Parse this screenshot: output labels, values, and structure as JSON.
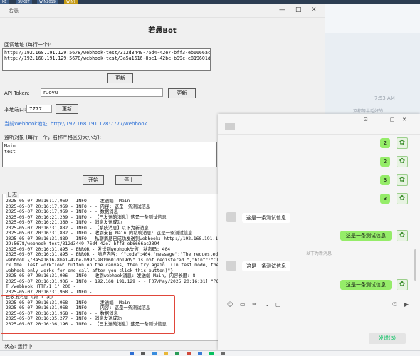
{
  "taskbar_top": {
    "tabs": [
      "KE",
      "SUKBT",
      "WIN2019",
      "WIN7"
    ]
  },
  "background": {
    "time": "7:53 AM",
    "snippet": "京都等半毛好的..."
  },
  "tk_window": {
    "title": "若愚",
    "heading": "若愚Bot",
    "callback_label": "回调地址 (每行一个):",
    "callback_text": "http://192.168.191.129:5678/webhook-test/312d3449-76d4-42e7-bff3-eb6666ac2394\nhttp://192.168.191.129:5678/webhook-test/3a5a1616-8be1-42be-b99c-e819601db19d",
    "update_btn_1": "更新",
    "api_token_label": "API Token:",
    "api_token_value": "ruoyu",
    "update_btn_2": "更新",
    "port_label": "本地端口:",
    "port_value": "7777",
    "update_btn_3": "更新",
    "webhook_link": "当前Webhook地址: http://192.168.191.128:7777/webhook",
    "monitor_label": "监听对象 (每行一个，名称严格区分大小写):",
    "monitor_text": "Main\ntest",
    "start_btn": "开始",
    "stop_btn": "停止",
    "log_caption": "日志",
    "log_text": "2025-05-07 20:16:17,969 - INFO - - 发送端: Main\n2025-05-07 20:16:17,969 - INFO - - 内容: 这是一条测试信息\n2025-05-07 20:16:17,969 - INFO - - 数据消息\n2025-05-07 20:16:21,209 - INFO - 【已发送的消息】这是一条测试信息\n2025-05-07 20:16:21,360 - INFO - 消息发送成功\n2025-05-07 20:16:31,882 - INFO - 【系统消息】以下为新消息\n2025-05-07 20:16:31,882 - INFO - 收到来自 Main 的私聊消息: 这是一条测试信息\n2025-05-07 20:16:31,889 - INFO - 私聊消息已成功发送到webhook: http://192.168.191.1\n29:5678/webhook-test/312d3449-76d4-42e7-bff3-eb6666ac2394\n2025-05-07 20:16:31,895 - ERROR - 发送到webhook失败，状态码: 404\n2025-05-07 20:16:31,895 - ERROR - 响应内容: {\"code\":404,\"message\":\"The requested\nwebhook \\\"3a5a1616-8be1-42be-b99c-e819601db19d\\\" is not registered.\",\"hint\":\"Cli\nck the 'Test workflow' button on the canvas, then try again. (In test mode, the\nwebhook only works for one call after you click this button)\"}\n2025-05-07 20:16:31,906 - INFO - 收到webhook消息: 发送端 Main, 内容长度: 8\n2025-05-07 20:16:31,906 - INFO - 192.168.191.129 - - [07/May/2025 20:16:31] \"POS\nT /webhook HTTP/1.1\" 200 -\n2025-05-07 20:16:31,968 - INFO -\n已收发消息 (第 1 次)\n2025-05-07 20:16:31,968 - INFO - - 发送端: Main\n2025-05-07 20:16:31,968 - INFO - - 内容: 这是一条测试信息\n2025-05-07 20:16:31,968 - INFO - - 数据消息\n2025-05-07 20:16:35,277 - INFO - 消息发送成功\n2025-05-07 20:16:36,196 - INFO - 【已发送的消息】这是一条测试信息",
    "status": "状态: 运行中"
  },
  "chat_window": {
    "controls": [
      "⊡",
      "—",
      "□",
      "✕"
    ],
    "green_numbers": [
      "2",
      "2",
      "3",
      "3"
    ],
    "msg_incoming_1": "这是一条测试信息",
    "msg_outgoing_1": "这是一条测试信息",
    "divider": "以下为新消息",
    "msg_incoming_2": "这是一条测试信息",
    "msg_outgoing_2": "这是一条测试信息",
    "send_button": "发送(S)"
  }
}
